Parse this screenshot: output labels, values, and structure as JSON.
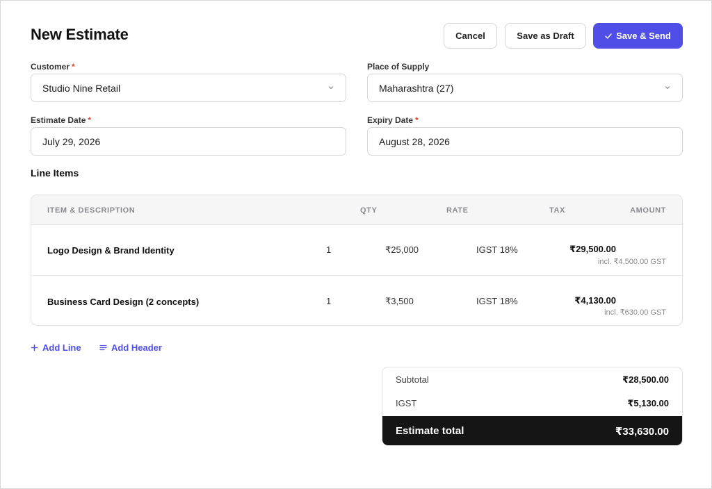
{
  "header": {
    "title": "New Estimate",
    "cancel_label": "Cancel",
    "draft_label": "Save as Draft",
    "send_label": "Save & Send"
  },
  "form": {
    "customer": {
      "label": "Customer",
      "required": "*",
      "value": "Studio Nine Retail"
    },
    "place_of_supply": {
      "label": "Place of Supply",
      "value": "Maharashtra (27)"
    },
    "estimate_date": {
      "label": "Estimate Date",
      "required": "*",
      "value": "July 29, 2026"
    },
    "expiry_date": {
      "label": "Expiry Date",
      "required": "*",
      "value": "August 28, 2026"
    }
  },
  "line_items": {
    "title": "Line Items",
    "columns": {
      "item": "ITEM & DESCRIPTION",
      "qty": "QTY",
      "rate": "RATE",
      "tax": "TAX",
      "amount": "AMOUNT"
    },
    "rows": [
      {
        "item": "Logo Design & Brand Identity",
        "qty": "1",
        "rate": "₹25,000",
        "tax": "IGST 18%",
        "amount": "₹29,500.00",
        "incl": "incl. ₹4,500.00 GST"
      },
      {
        "item": "Business Card Design (2 concepts)",
        "qty": "1",
        "rate": "₹3,500",
        "tax": "IGST 18%",
        "amount": "₹4,130.00",
        "incl": "incl. ₹630.00 GST"
      }
    ]
  },
  "actions": {
    "add_line": "Add Line",
    "add_header": "Add Header"
  },
  "totals": {
    "subtotal_label": "Subtotal",
    "subtotal_value": "₹28,500.00",
    "tax_label": "IGST",
    "tax_value": "₹5,130.00",
    "total_label": "Estimate total",
    "total_value": "₹33,630.00"
  },
  "colors": {
    "accent": "#4f4fe8",
    "required": "#d9453a",
    "total_bar": "#151515"
  },
  "icons": [
    "check-icon",
    "chevron-down-icon",
    "plus-icon",
    "lines-icon"
  ]
}
